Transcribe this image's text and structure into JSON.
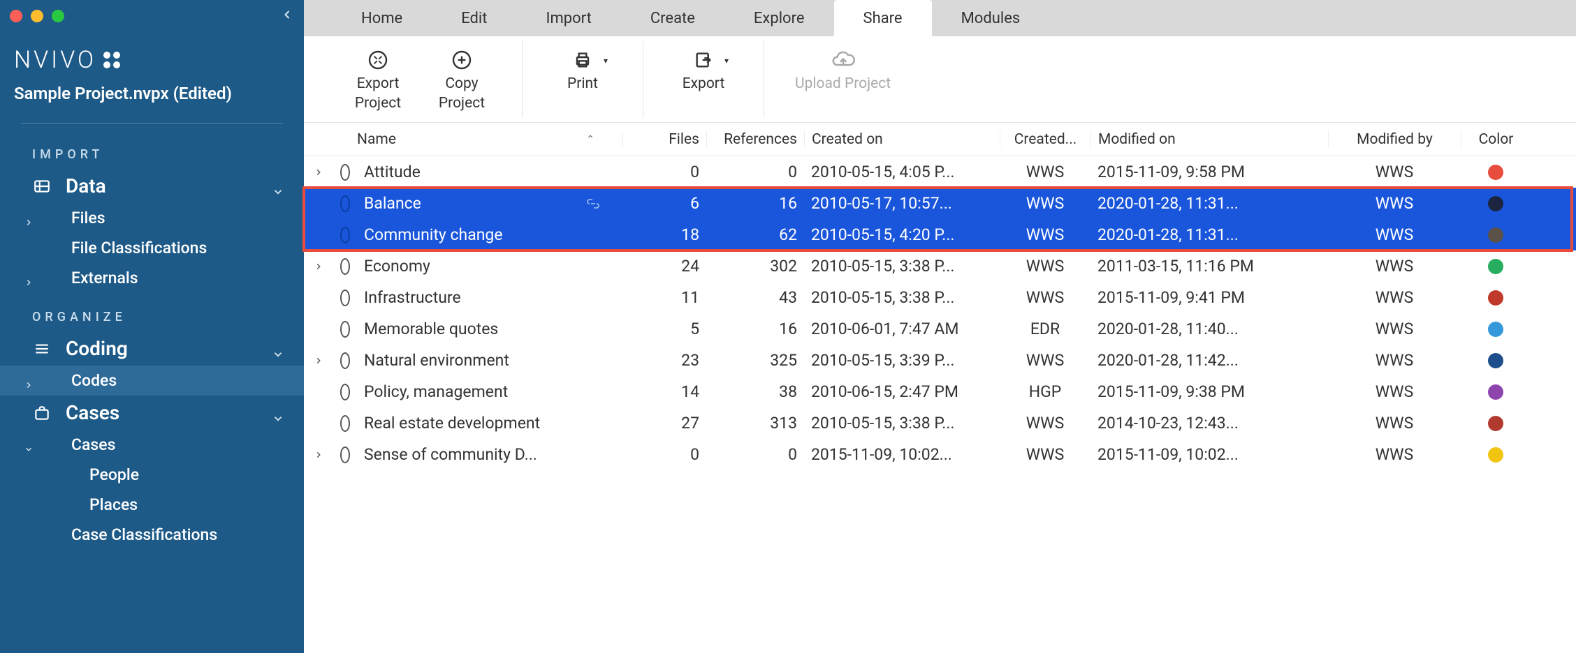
{
  "project_title": "Sample Project.nvpx (Edited)",
  "brand": "NVIVO",
  "sidebar": {
    "sections": {
      "import": {
        "label": "IMPORT"
      },
      "organize": {
        "label": "ORGANIZE"
      }
    },
    "data": {
      "label": "Data"
    },
    "files": {
      "label": "Files"
    },
    "file_classifications": {
      "label": "File Classifications"
    },
    "externals": {
      "label": "Externals"
    },
    "coding": {
      "label": "Coding"
    },
    "codes": {
      "label": "Codes"
    },
    "cases": {
      "label": "Cases"
    },
    "cases_sub": {
      "label": "Cases"
    },
    "people": {
      "label": "People"
    },
    "places": {
      "label": "Places"
    },
    "case_classifications": {
      "label": "Case Classifications"
    }
  },
  "tabs": [
    {
      "label": "Home"
    },
    {
      "label": "Edit"
    },
    {
      "label": "Import"
    },
    {
      "label": "Create"
    },
    {
      "label": "Explore"
    },
    {
      "label": "Share",
      "active": true
    },
    {
      "label": "Modules"
    }
  ],
  "ribbon": {
    "export_project": {
      "line1": "Export",
      "line2": "Project"
    },
    "copy_project": {
      "line1": "Copy",
      "line2": "Project"
    },
    "print": {
      "label": "Print"
    },
    "export": {
      "label": "Export"
    },
    "upload": {
      "label": "Upload Project"
    }
  },
  "columns": {
    "name": "Name",
    "files": "Files",
    "references": "References",
    "created_on": "Created on",
    "created_by": "Created...",
    "modified_on": "Modified on",
    "modified_by": "Modified by",
    "color": "Color"
  },
  "rows": [
    {
      "expandable": true,
      "name": "Attitude",
      "files": "0",
      "refs": "0",
      "created": "2010-05-15, 4:05 P...",
      "cby": "WWS",
      "modified": "2015-11-09, 9:58 PM",
      "mby": "WWS",
      "color": "#e74c3c",
      "selected": false
    },
    {
      "expandable": false,
      "name": "Balance",
      "files": "6",
      "refs": "16",
      "created": "2010-05-17, 10:57...",
      "cby": "WWS",
      "modified": "2020-01-28, 11:31...",
      "mby": "WWS",
      "color": "#1b2540",
      "selected": true,
      "link": true
    },
    {
      "expandable": false,
      "name": "Community change",
      "files": "18",
      "refs": "62",
      "created": "2010-05-15, 4:20 P...",
      "cby": "WWS",
      "modified": "2020-01-28, 11:31...",
      "mby": "WWS",
      "color": "#5a5148",
      "selected": true
    },
    {
      "expandable": true,
      "name": "Economy",
      "files": "24",
      "refs": "302",
      "created": "2010-05-15, 3:38 P...",
      "cby": "WWS",
      "modified": "2011-03-15, 11:16 PM",
      "mby": "WWS",
      "color": "#27ae60",
      "selected": false
    },
    {
      "expandable": false,
      "name": "Infrastructure",
      "files": "11",
      "refs": "43",
      "created": "2010-05-15, 3:38 P...",
      "cby": "WWS",
      "modified": "2015-11-09, 9:41 PM",
      "mby": "WWS",
      "color": "#c0392b",
      "selected": false
    },
    {
      "expandable": false,
      "name": "Memorable quotes",
      "files": "5",
      "refs": "16",
      "created": "2010-06-01, 7:47 AM",
      "cby": "EDR",
      "modified": "2020-01-28, 11:40...",
      "mby": "WWS",
      "color": "#3498db",
      "selected": false
    },
    {
      "expandable": true,
      "name": "Natural environment",
      "files": "23",
      "refs": "325",
      "created": "2010-05-15, 3:39 P...",
      "cby": "WWS",
      "modified": "2020-01-28, 11:42...",
      "mby": "WWS",
      "color": "#1d4e89",
      "selected": false
    },
    {
      "expandable": false,
      "name": "Policy, management",
      "files": "14",
      "refs": "38",
      "created": "2010-06-15, 2:47 PM",
      "cby": "HGP",
      "modified": "2015-11-09, 9:38 PM",
      "mby": "WWS",
      "color": "#8e44ad",
      "selected": false
    },
    {
      "expandable": false,
      "name": "Real estate development",
      "files": "27",
      "refs": "313",
      "created": "2010-05-15, 3:38 P...",
      "cby": "WWS",
      "modified": "2014-10-23, 12:43...",
      "mby": "WWS",
      "color": "#b03a2e",
      "selected": false
    },
    {
      "expandable": true,
      "name": "Sense of community D...",
      "files": "0",
      "refs": "0",
      "created": "2015-11-09, 10:02...",
      "cby": "WWS",
      "modified": "2015-11-09, 10:02...",
      "mby": "WWS",
      "color": "#f1c40f",
      "selected": false
    }
  ]
}
